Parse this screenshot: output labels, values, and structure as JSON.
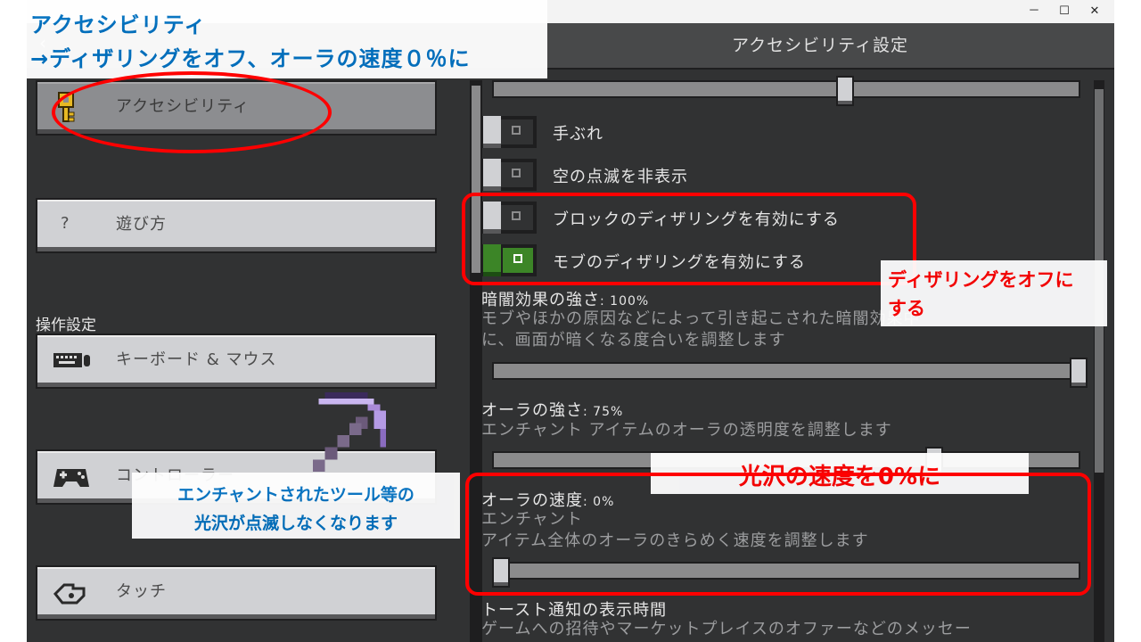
{
  "window": {
    "title": "アクセシビリティ設定",
    "controls": [
      "－",
      "☐",
      "✕"
    ]
  },
  "sidebar": {
    "items": [
      {
        "label": "アクセシビリティ",
        "icon": "key-icon",
        "active": true
      },
      {
        "label": "遊び方",
        "icon": "question-icon"
      },
      {
        "label": "キーボード & マウス",
        "icon": "keyboard-icon"
      },
      {
        "label": "コントローラー",
        "icon": "gamepad-icon"
      },
      {
        "label": "タッチ",
        "icon": "touch-icon"
      }
    ],
    "section_heading": "操作設定",
    "help_glyph": "?"
  },
  "main": {
    "toggles": [
      {
        "label": "手ぶれ",
        "on": false
      },
      {
        "label": "空の点滅を非表示",
        "on": false
      },
      {
        "label": "ブロックのディザリングを有効にする",
        "on": false
      },
      {
        "label": "モブのディザリングを有効にする",
        "on": true
      }
    ],
    "darkness": {
      "title": "暗闇効果の強さ",
      "value": ": 100%",
      "description_1": "モブやほかの原因などによって引き起こされた暗闇効果中",
      "description_2": "に、画面が暗くなる度合いを調整します",
      "level": 1.0
    },
    "aura_strength": {
      "title": "オーラの強さ",
      "value": ": 75%",
      "description_1": "エンチャント アイテムのオーラの透明度を調整します",
      "level": 0.75
    },
    "aura_speed": {
      "title": "オーラの速度",
      "value": ": 0%",
      "description_1": "エンチャント",
      "description_2": "アイテム全体のオーラのきらめく速度を調整します",
      "level": 0.0
    },
    "toast": {
      "title": "トースト通知の表示時間",
      "description_1": "ゲームへの招待やマーケットプレイスのオファーなどのメッセー"
    },
    "top_slider_level": 0.6
  },
  "annotations": {
    "top_line_1": "アクセシビリティ",
    "top_line_2": "→ディザリングをオフ、オーラの速度０％に",
    "dither_note_1": "ディザリングをオフに",
    "dither_note_2": "する",
    "speed_note": "光沢の速度を0%に",
    "enchant_note_1": "エンチャントされたツール等の",
    "enchant_note_2": "光沢が点滅しなくなります",
    "color_red": "#ff0000",
    "color_blue": "#0070c0"
  }
}
